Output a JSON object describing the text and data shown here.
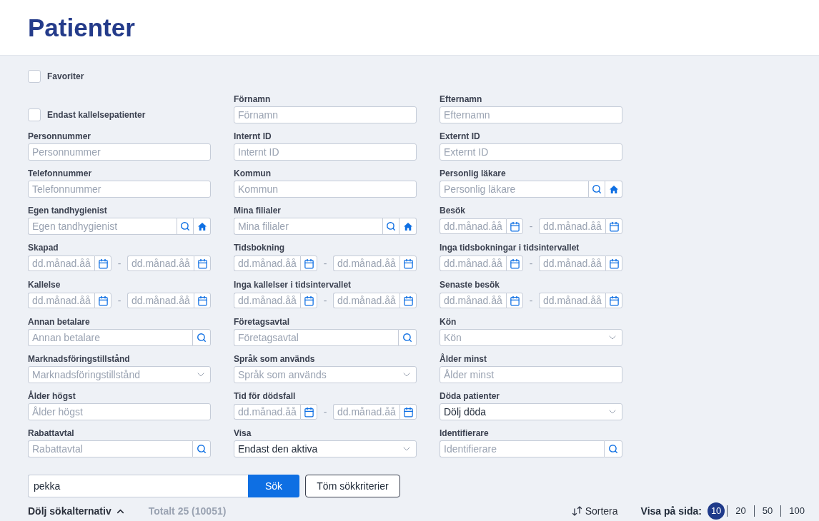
{
  "header": {
    "title": "Patienter"
  },
  "favorites": {
    "label": "Favoriter",
    "checked": false
  },
  "filters": [
    {
      "kind": "checkbox",
      "label": "Endast kallelsepatienter",
      "checked": false
    },
    {
      "kind": "text",
      "label": "Förnamn",
      "placeholder": "Förnamn"
    },
    {
      "kind": "text",
      "label": "Efternamn",
      "placeholder": "Efternamn"
    },
    {
      "kind": "text",
      "label": "Personnummer",
      "placeholder": "Personnummer"
    },
    {
      "kind": "text",
      "label": "Internt ID",
      "placeholder": "Internt ID"
    },
    {
      "kind": "text",
      "label": "Externt ID",
      "placeholder": "Externt ID"
    },
    {
      "kind": "text",
      "label": "Telefonnummer",
      "placeholder": "Telefonnummer"
    },
    {
      "kind": "text",
      "label": "Kommun",
      "placeholder": "Kommun"
    },
    {
      "kind": "lookup",
      "label": "Personlig läkare",
      "placeholder": "Personlig läkare"
    },
    {
      "kind": "lookup",
      "label": "Egen tandhygienist",
      "placeholder": "Egen tandhygienist"
    },
    {
      "kind": "lookup",
      "label": "Mina filialer",
      "placeholder": "Mina filialer"
    },
    {
      "kind": "daterange",
      "label": "Besök",
      "from": {
        "placeholder": "dd.månad.åå"
      },
      "separator": "-",
      "to": {
        "placeholder": "dd.månad.åå"
      }
    },
    {
      "kind": "daterange",
      "label": "Skapad",
      "from": {
        "placeholder": "dd.månad.åå"
      },
      "separator": "-",
      "to": {
        "placeholder": "dd.månad.åå"
      }
    },
    {
      "kind": "daterange",
      "label": "Tidsbokning",
      "from": {
        "placeholder": "dd.månad.åå"
      },
      "separator": "-",
      "to": {
        "placeholder": "dd.månad.åå"
      }
    },
    {
      "kind": "daterange",
      "label": "Inga tidsbokningar i tidsintervallet",
      "from": {
        "placeholder": "dd.månad.åå"
      },
      "separator": "-",
      "to": {
        "placeholder": "dd.månad.åå"
      }
    },
    {
      "kind": "daterange",
      "label": "Kallelse",
      "from": {
        "placeholder": "dd.månad.åå"
      },
      "separator": "-",
      "to": {
        "placeholder": "dd.månad.åå"
      }
    },
    {
      "kind": "daterange",
      "label": "Inga kallelser i tidsintervallet",
      "from": {
        "placeholder": "dd.månad.åå"
      },
      "separator": "-",
      "to": {
        "placeholder": "dd.månad.åå"
      }
    },
    {
      "kind": "daterange",
      "label": "Senaste besök",
      "from": {
        "placeholder": "dd.månad.åå"
      },
      "separator": "-",
      "to": {
        "placeholder": "dd.månad.åå"
      }
    },
    {
      "kind": "search",
      "label": "Annan betalare",
      "placeholder": "Annan betalare"
    },
    {
      "kind": "search",
      "label": "Företagsavtal",
      "placeholder": "Företagsavtal"
    },
    {
      "kind": "select",
      "label": "Kön",
      "placeholder": "Kön"
    },
    {
      "kind": "select",
      "label": "Marknadsföringstillstånd",
      "placeholder": "Marknadsföringstillstånd"
    },
    {
      "kind": "select",
      "label": "Språk som används",
      "placeholder": "Språk som används"
    },
    {
      "kind": "text",
      "label": "Ålder minst",
      "placeholder": "Ålder minst"
    },
    {
      "kind": "text",
      "label": "Ålder högst",
      "placeholder": "Ålder högst"
    },
    {
      "kind": "daterange",
      "label": "Tid för dödsfall",
      "from": {
        "placeholder": "dd.månad.åå"
      },
      "separator": "-",
      "to": {
        "placeholder": "dd.månad.åå"
      }
    },
    {
      "kind": "select",
      "label": "Döda patienter",
      "value": "Dölj döda"
    },
    {
      "kind": "search",
      "label": "Rabattavtal",
      "placeholder": "Rabattavtal"
    },
    {
      "kind": "select",
      "label": "Visa",
      "value": "Endast den aktiva"
    },
    {
      "kind": "search",
      "label": "Identifierare",
      "placeholder": "Identifierare"
    }
  ],
  "search_bar": {
    "value": "pekka",
    "search_button": "Sök",
    "clear_button": "Töm sökkriterier"
  },
  "footer": {
    "toggle": "Dölj sökalternativ",
    "total": "Totalt 25 (10051)",
    "sort": "Sortera",
    "page_size_label": "Visa på sida:",
    "page_sizes": [
      {
        "label": "10",
        "selected": true
      },
      {
        "label": "20",
        "selected": false
      },
      {
        "label": "50",
        "selected": false
      },
      {
        "label": "100",
        "selected": false
      }
    ]
  }
}
